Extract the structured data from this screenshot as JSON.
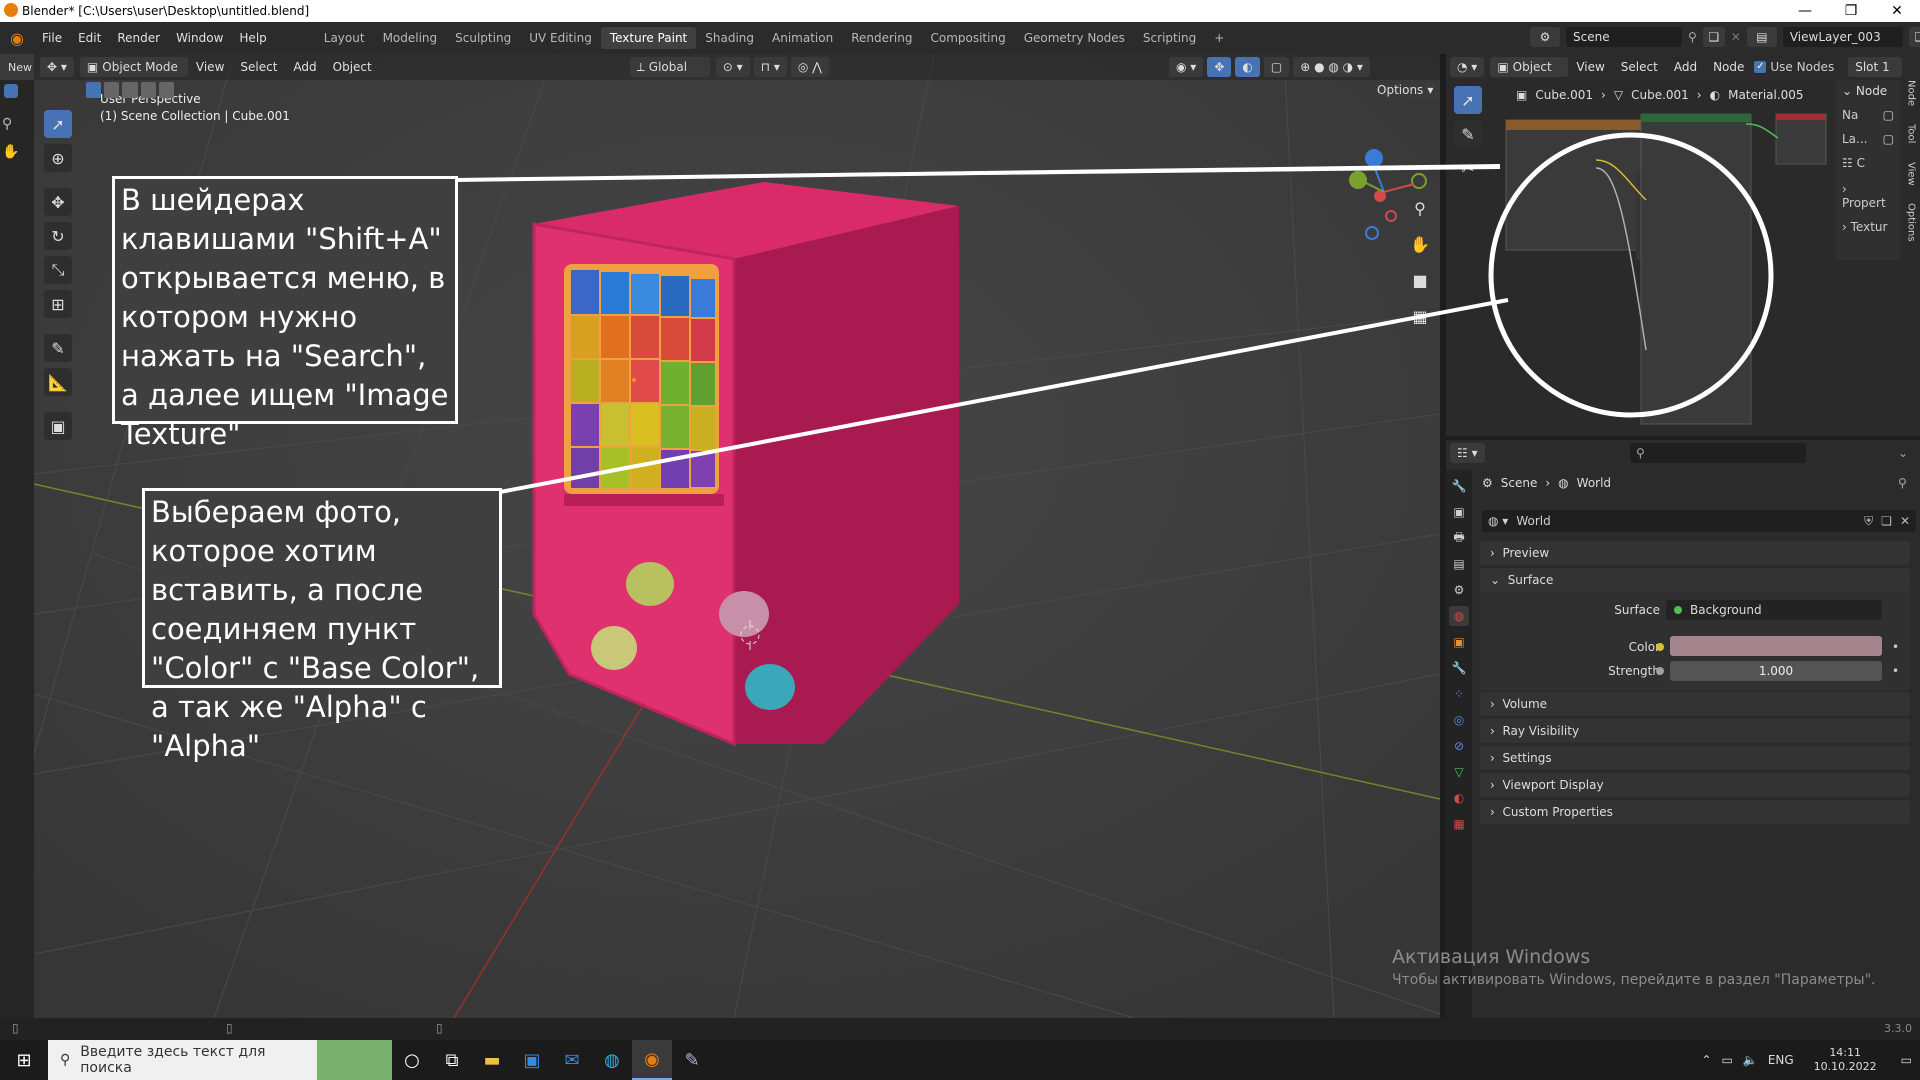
{
  "window": {
    "title": "Blender* [C:\\Users\\user\\Desktop\\untitled.blend]",
    "minimize": "—",
    "maximize": "❐",
    "close": "✕"
  },
  "menu": {
    "items": [
      "File",
      "Edit",
      "Render",
      "Window",
      "Help"
    ],
    "workspaces": [
      "Layout",
      "Modeling",
      "Sculpting",
      "UV Editing",
      "Texture Paint",
      "Shading",
      "Animation",
      "Rendering",
      "Compositing",
      "Geometry Nodes",
      "Scripting"
    ],
    "active_workspace": "Texture Paint",
    "add_workspace": "+",
    "scene": "Scene",
    "view_layer": "ViewLayer_003"
  },
  "viewport": {
    "new_label": "New",
    "mode": "Object Mode",
    "menus": [
      "View",
      "Select",
      "Add",
      "Object"
    ],
    "transform_orientation": "Global",
    "options_label": "Options",
    "view_name": "User Perspective",
    "collection_info": "(1) Scene Collection | Cube.001"
  },
  "callouts": {
    "top": "В шейдерах клавишами \"Shift+A\" открывается меню, в котором нужно нажать на \"Search\", а далее ищем \"Image Texture\"",
    "bottom": "Выбераем фото, которое хотим вставить, а после соединяем пункт \"Color\" с \"Base Color\", а так же \"Alpha\" с \"Alpha\""
  },
  "node_editor": {
    "type": "Object",
    "menus": [
      "View",
      "Select",
      "Add",
      "Node"
    ],
    "use_nodes_label": "Use Nodes",
    "slot": "Slot 1",
    "breadcrumb": [
      "Cube.001",
      "Cube.001",
      "Material.005"
    ],
    "side_tabs": [
      "Node",
      "Tool",
      "View",
      "Options"
    ],
    "side_labels": [
      "Node",
      "Na",
      "La...",
      "C",
      "Propert",
      "Textur"
    ]
  },
  "properties": {
    "breadcrumb": [
      "Scene",
      "World"
    ],
    "world_name": "World",
    "panels": {
      "preview": "Preview",
      "surface": "Surface",
      "volume": "Volume",
      "ray_visibility": "Ray Visibility",
      "settings": "Settings",
      "viewport_display": "Viewport Display",
      "custom_properties": "Custom Properties"
    },
    "surface_label": "Surface",
    "surface_value": "Background",
    "color_label": "Color",
    "color_value": "#a4858e",
    "strength_label": "Strength",
    "strength_value": "1.000"
  },
  "watermark": {
    "title": "Активация Windows",
    "subtitle": "Чтобы активировать Windows, перейдите в раздел \"Параметры\"."
  },
  "status": {
    "version": "3.3.0"
  },
  "taskbar": {
    "search_placeholder": "Введите здесь текст для поиска",
    "lang": "ENG",
    "time": "14:11",
    "date": "10.10.2022"
  },
  "colors": {
    "accent": "#4772b3",
    "cabinet": "#e0316f",
    "cabinet_dark": "#b81e58",
    "screen_frame": "#f0a040"
  }
}
